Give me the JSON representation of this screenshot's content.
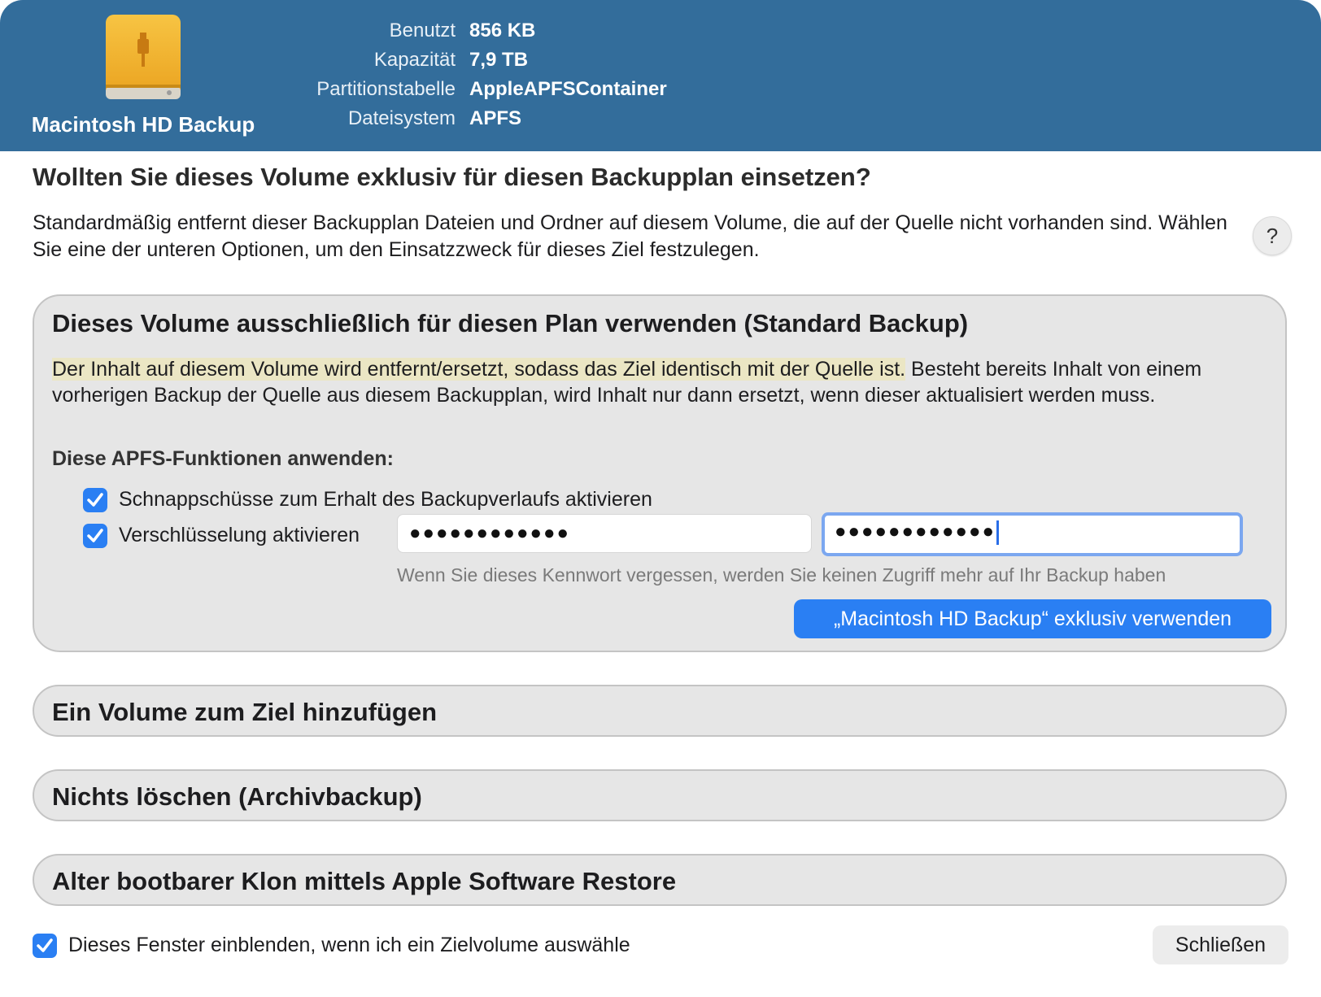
{
  "header": {
    "volume_name": "Macintosh HD Backup",
    "icon": "external-drive-icon",
    "info": [
      {
        "key": "Benutzt",
        "value": "856 KB"
      },
      {
        "key": "Kapazität",
        "value": "7,9 TB"
      },
      {
        "key": "Partitionstabelle",
        "value": "AppleAPFSContainer"
      },
      {
        "key": "Dateisystem",
        "value": "APFS"
      }
    ]
  },
  "title": "Wollten Sie dieses Volume exklusiv für diesen Backupplan einsetzen?",
  "intro": "Standardmäßig entfernt dieser Backupplan Dateien und Ordner auf diesem Volume, die auf der Quelle nicht vorhanden sind. Wählen Sie eine der unteren Optionen, um den Einsatzzweck für dieses Ziel festzulegen.",
  "help_label": "?",
  "options": {
    "standard": {
      "title": "Dieses Volume ausschließlich für diesen Plan verwenden (Standard Backup)",
      "desc_highlight": "Der Inhalt auf diesem Volume wird entfernt/ersetzt, sodass das Ziel identisch mit der Quelle ist.",
      "desc_rest": " Besteht bereits Inhalt von einem vorherigen Backup der Quelle aus diesem Backupplan, wird Inhalt nur dann ersetzt, wenn dieser aktualisiert werden muss.",
      "apfs_label": "Diese APFS-Funktionen anwenden:",
      "snapshots_label": "Schnappschüsse zum Erhalt des Backupverlaufs aktivieren",
      "snapshots_checked": true,
      "encryption_label": "Verschlüsselung aktivieren",
      "encryption_checked": true,
      "password": "●●●●●●●●●●●●",
      "password_confirm": "●●●●●●●●●●●●",
      "hint": "Wenn Sie dieses Kennwort vergessen, werden Sie keinen Zugriff mehr auf Ihr Backup haben",
      "button": "„Macintosh HD Backup“ exklusiv verwenden"
    },
    "add_volume": {
      "title": "Ein Volume zum Ziel hinzufügen"
    },
    "archive": {
      "title": "Nichts löschen (Archivbackup)"
    },
    "legacy": {
      "title": "Alter bootbarer Klon mittels Apple Software Restore"
    }
  },
  "footer": {
    "show_window_label": "Dieses Fenster einblenden, wenn ich ein Zielvolume auswähle",
    "show_window_checked": true,
    "close_button": "Schließen"
  },
  "colors": {
    "header_bg": "#336d9b",
    "accent": "#2a7ff3",
    "highlight": "#ebe6c4",
    "panel_bg": "#e6e6e6"
  }
}
